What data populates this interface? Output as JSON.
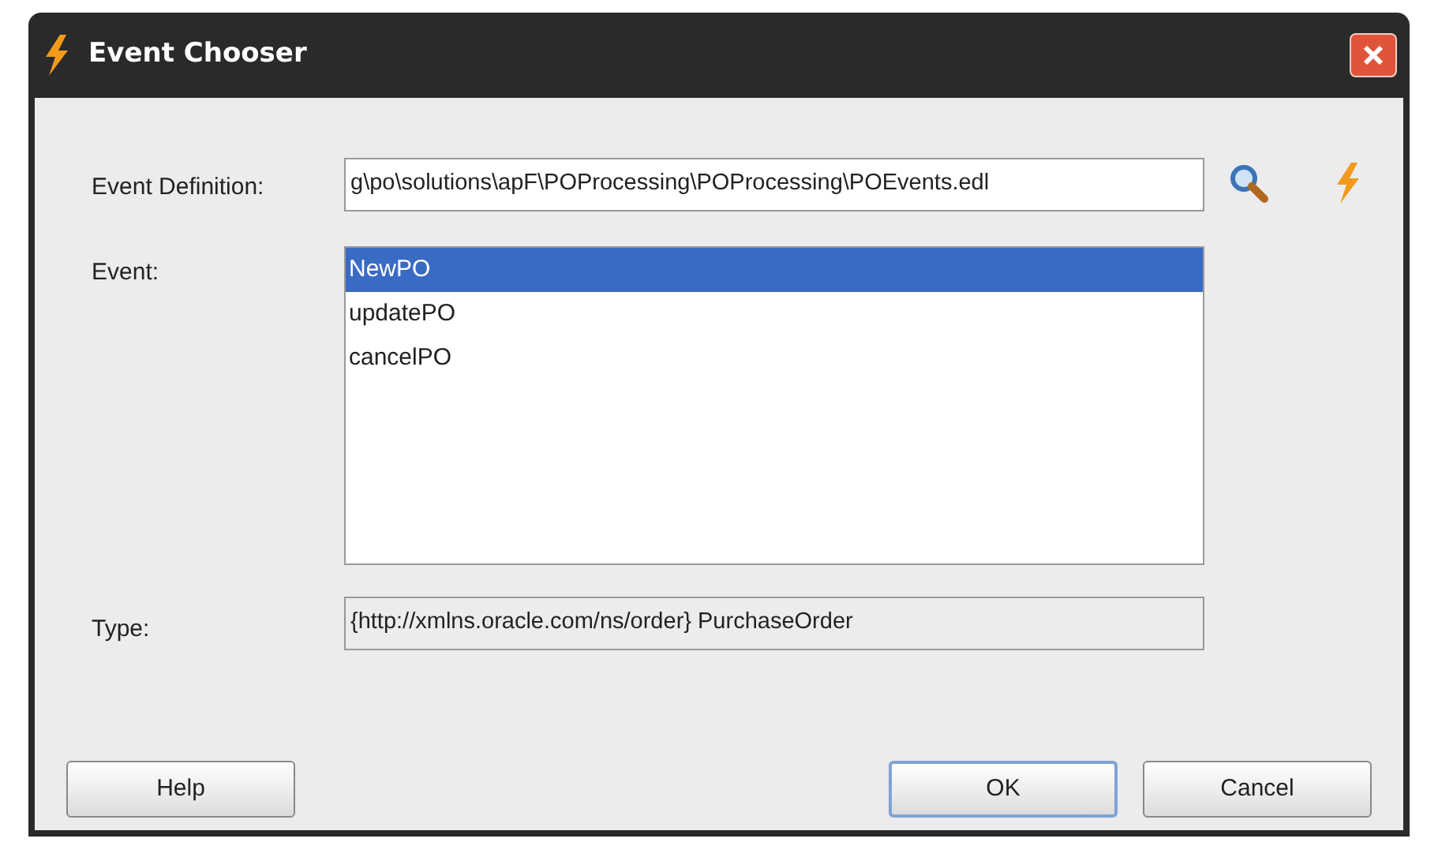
{
  "window": {
    "title": "Event Chooser"
  },
  "event_definition": {
    "label": "Event Definition:",
    "value": "g\\po\\solutions\\apF\\POProcessing\\POProcessing\\POEvents.edl"
  },
  "event": {
    "label": "Event:",
    "items": [
      {
        "label": "NewPO",
        "selected": true
      },
      {
        "label": "updatePO",
        "selected": false
      },
      {
        "label": "cancelPO",
        "selected": false
      }
    ]
  },
  "type": {
    "label": "Type:",
    "value": "{http://xmlns.oracle.com/ns/order} PurchaseOrder"
  },
  "buttons": [
    {
      "label": "Help",
      "default": false
    },
    {
      "label": "OK",
      "default": true
    },
    {
      "label": "Cancel",
      "default": false
    }
  ]
}
